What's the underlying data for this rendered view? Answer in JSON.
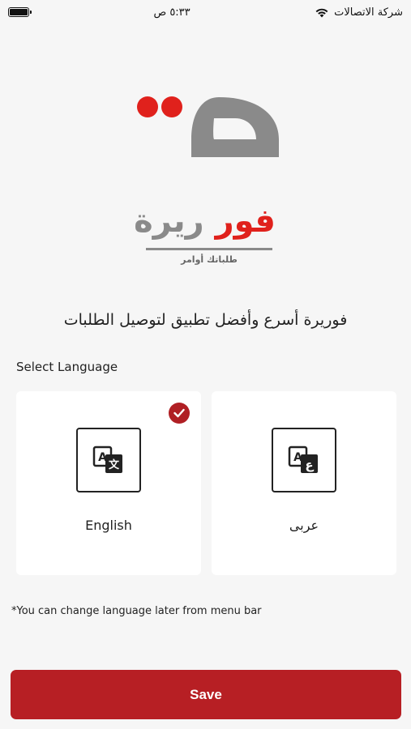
{
  "status_bar": {
    "carrier": "شركة الاتصالات",
    "time": "٥:٣٣ ص"
  },
  "brand": {
    "name_part1": "فور",
    "name_part2": "ريرة",
    "subtitle": "طلباتك أوامر",
    "colors": {
      "red": "#e0211c",
      "gray": "#8a8a8a"
    }
  },
  "tagline": "فوريرة أسرع وأفضل تطبيق لتوصيل الطلبات",
  "select_language_label": "Select Language",
  "languages": [
    {
      "label": "English",
      "icon": "translate-a-x-icon",
      "selected": true
    },
    {
      "label": "عربى",
      "icon": "translate-a-ain-icon",
      "selected": false
    }
  ],
  "note": "*You can change language later from menu bar",
  "save_label": "Save",
  "accent_color": "#b71f24"
}
